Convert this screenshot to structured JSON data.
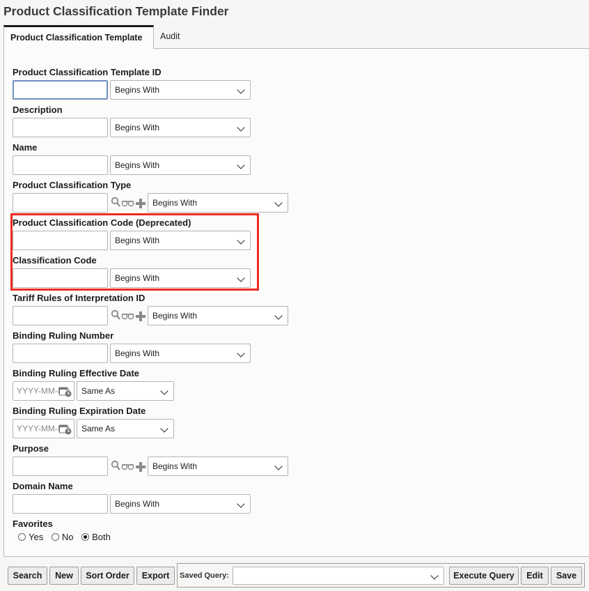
{
  "page": {
    "title": "Product Classification Template Finder"
  },
  "tabs": [
    {
      "label": "Product Classification Template"
    },
    {
      "label": "Audit"
    }
  ],
  "fields": {
    "template_id": {
      "label": "Product Classification Template ID",
      "value": "",
      "operator": "Begins With"
    },
    "description": {
      "label": "Description",
      "value": "",
      "operator": "Begins With"
    },
    "name": {
      "label": "Name",
      "value": "",
      "operator": "Begins With"
    },
    "type": {
      "label": "Product Classification Type",
      "value": "",
      "operator": "Begins With"
    },
    "pc_code_deprecated": {
      "label": "Product Classification Code (Deprecated)",
      "value": "",
      "operator": "Begins With"
    },
    "classification_code": {
      "label": "Classification Code",
      "value": "",
      "operator": "Begins With"
    },
    "tariff_rules": {
      "label": "Tariff Rules of Interpretation ID",
      "value": "",
      "operator": "Begins With"
    },
    "binding_ruling_number": {
      "label": "Binding Ruling Number",
      "value": "",
      "operator": "Begins With"
    },
    "binding_ruling_effective": {
      "label": "Binding Ruling Effective Date",
      "placeholder": "YYYY-MM-DD",
      "operator": "Same As"
    },
    "binding_ruling_expiration": {
      "label": "Binding Ruling Expiration Date",
      "placeholder": "YYYY-MM-DD",
      "operator": "Same As"
    },
    "purpose": {
      "label": "Purpose",
      "value": "",
      "operator": "Begins With"
    },
    "domain_name": {
      "label": "Domain Name",
      "value": "",
      "operator": "Begins With"
    }
  },
  "favorites": {
    "label": "Favorites",
    "options": [
      "Yes",
      "No",
      "Both"
    ],
    "selected": "Both"
  },
  "footer": {
    "search": "Search",
    "new": "New",
    "sort_order": "Sort Order",
    "export": "Export",
    "saved_query_label": "Saved Query:",
    "saved_query_value": "",
    "execute_query": "Execute Query",
    "edit": "Edit",
    "save": "Save"
  },
  "icons": {
    "lookup": "search-icon",
    "view": "glasses-icon",
    "add": "plus-icon",
    "date": "calendar-icon"
  },
  "colors": {
    "highlight": "#ee2b22",
    "focus": "#6f8fbf"
  }
}
